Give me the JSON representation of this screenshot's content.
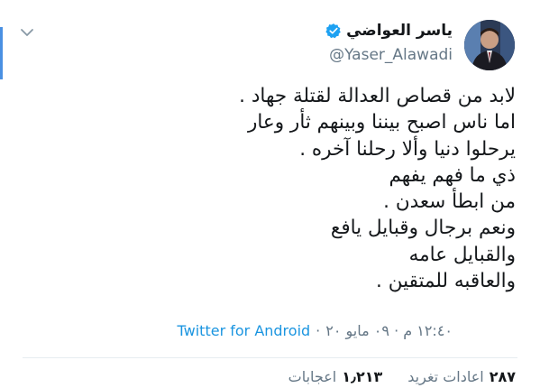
{
  "user": {
    "name": "ياسر العواضي",
    "handle": "@Yaser_Alawadi"
  },
  "tweet": {
    "lines": [
      "لابد من قصاص العدالة لقتلة جهاد .",
      "اما ناس اصبح بيننا وبينهم ثأر وعار",
      "يرحلوا دنيا  وألا رحلنا آخره .",
      "ذي ما فهم يفهم",
      " من ابطأ  سعدن .",
      "ونعم برجال وقبايل يافع",
      "والقبايل عامه",
      "والعاقبه للمتقين ."
    ]
  },
  "meta": {
    "time": "١٢:٤٠ م · ٠٩ مايو ٢٠",
    "separator": "·",
    "source": "Twitter for Android"
  },
  "stats": {
    "retweets_count": "٢٨٧",
    "retweets_label": "اعادات تغريد",
    "likes_count": "١٫٢١٣",
    "likes_label": "اعجابات"
  },
  "colors": {
    "accent": "#1b95e0",
    "verified": "#1da1f2",
    "muted": "#657786"
  },
  "icons": {
    "menu": "chevron-down-icon",
    "verified": "verified-badge-icon"
  }
}
